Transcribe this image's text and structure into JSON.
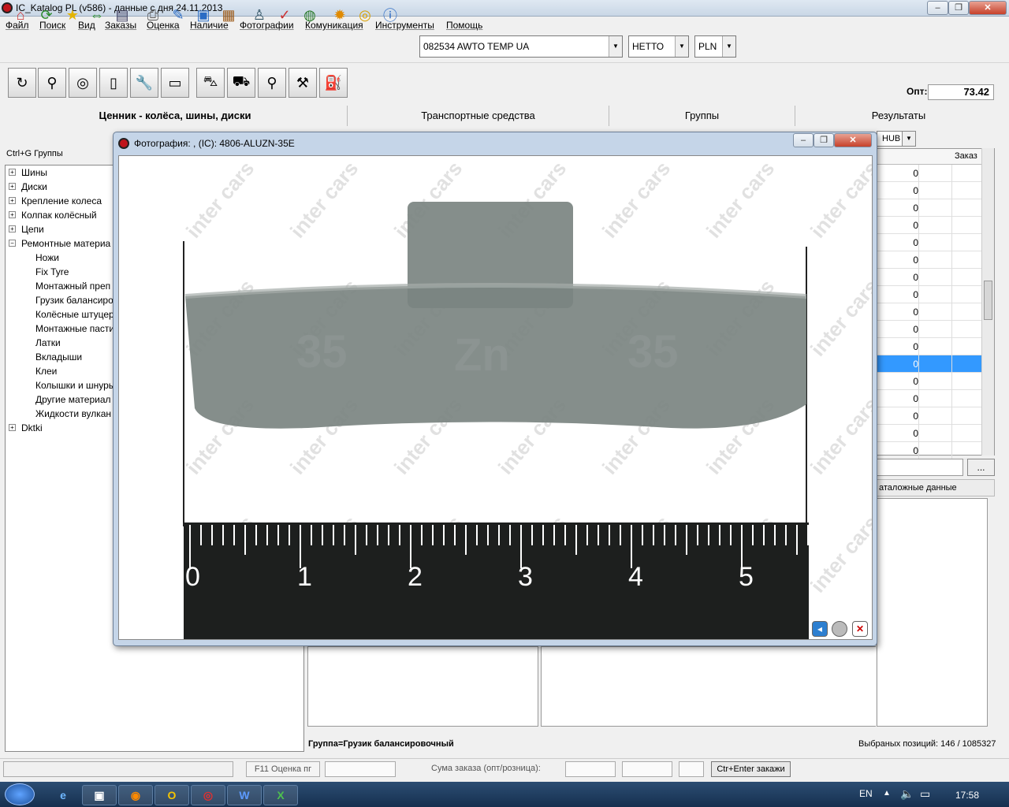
{
  "window": {
    "title": "IC_Katalog PL (v586) - данные с дня 24.11.2013"
  },
  "menu": [
    "Файл",
    "Поиск",
    "Вид",
    "Заказы",
    "Оценка",
    "Наличие",
    "Фотографии",
    "Комуникация",
    "Инструменты",
    "Помощь"
  ],
  "client": {
    "value": "082534  AWTO TEMP UA",
    "net": "НЕТТО",
    "currency": "PLN"
  },
  "opt": {
    "label": "Опт:",
    "value": "73.42"
  },
  "panels": {
    "left": "Ценник - колёса, шины, диски",
    "vehicles": "Транспортные средства",
    "groups": "Группы",
    "results": "Результаты"
  },
  "tree": {
    "shortcut": "Ctrl+G Группы",
    "roots": [
      "Шины",
      "Диски",
      "Крепление колеса",
      "Колпак колёсный",
      "Цепи",
      "Ремонтные материа"
    ],
    "children": [
      "Ножи",
      "Fix Tyre",
      "Монтажный преп",
      "Грузик балансиро",
      "Колёсные штуцер",
      "Монтажные пасти",
      "Латки",
      "Вкладыши",
      "Клеи",
      "Колышки и шнуры",
      "Другие материал",
      "Жидкости вулкан"
    ],
    "last": "Dktki"
  },
  "grid": {
    "filter": "HUB",
    "order_header": "Заказ",
    "values": [
      "0",
      "0",
      "0",
      "0",
      "0",
      "0",
      "0",
      "0",
      "0",
      "0",
      "0",
      "0",
      "0",
      "0",
      "0",
      "0",
      "0"
    ],
    "selected_index": 11
  },
  "lower_tab": "аталожные данные",
  "photo": {
    "title": "Фотография: , (IC): 4806-ALUZN-35E",
    "watermark": "inter cars",
    "stamp_text": "Zn",
    "weight_text": "35",
    "ruler_labels": [
      "0",
      "1",
      "2",
      "3",
      "4",
      "5"
    ]
  },
  "footer": {
    "group": "Группа=Грузик балансировочный",
    "selected": "Выбраных позиций: 146 / 1085327"
  },
  "status": {
    "f11": "F11 Оценка пг",
    "sum_label": "Сума заказа (опт/розница):",
    "submit": "Ctr+Enter закажи"
  },
  "taskbar": {
    "lang": "EN",
    "time": "17:58"
  }
}
